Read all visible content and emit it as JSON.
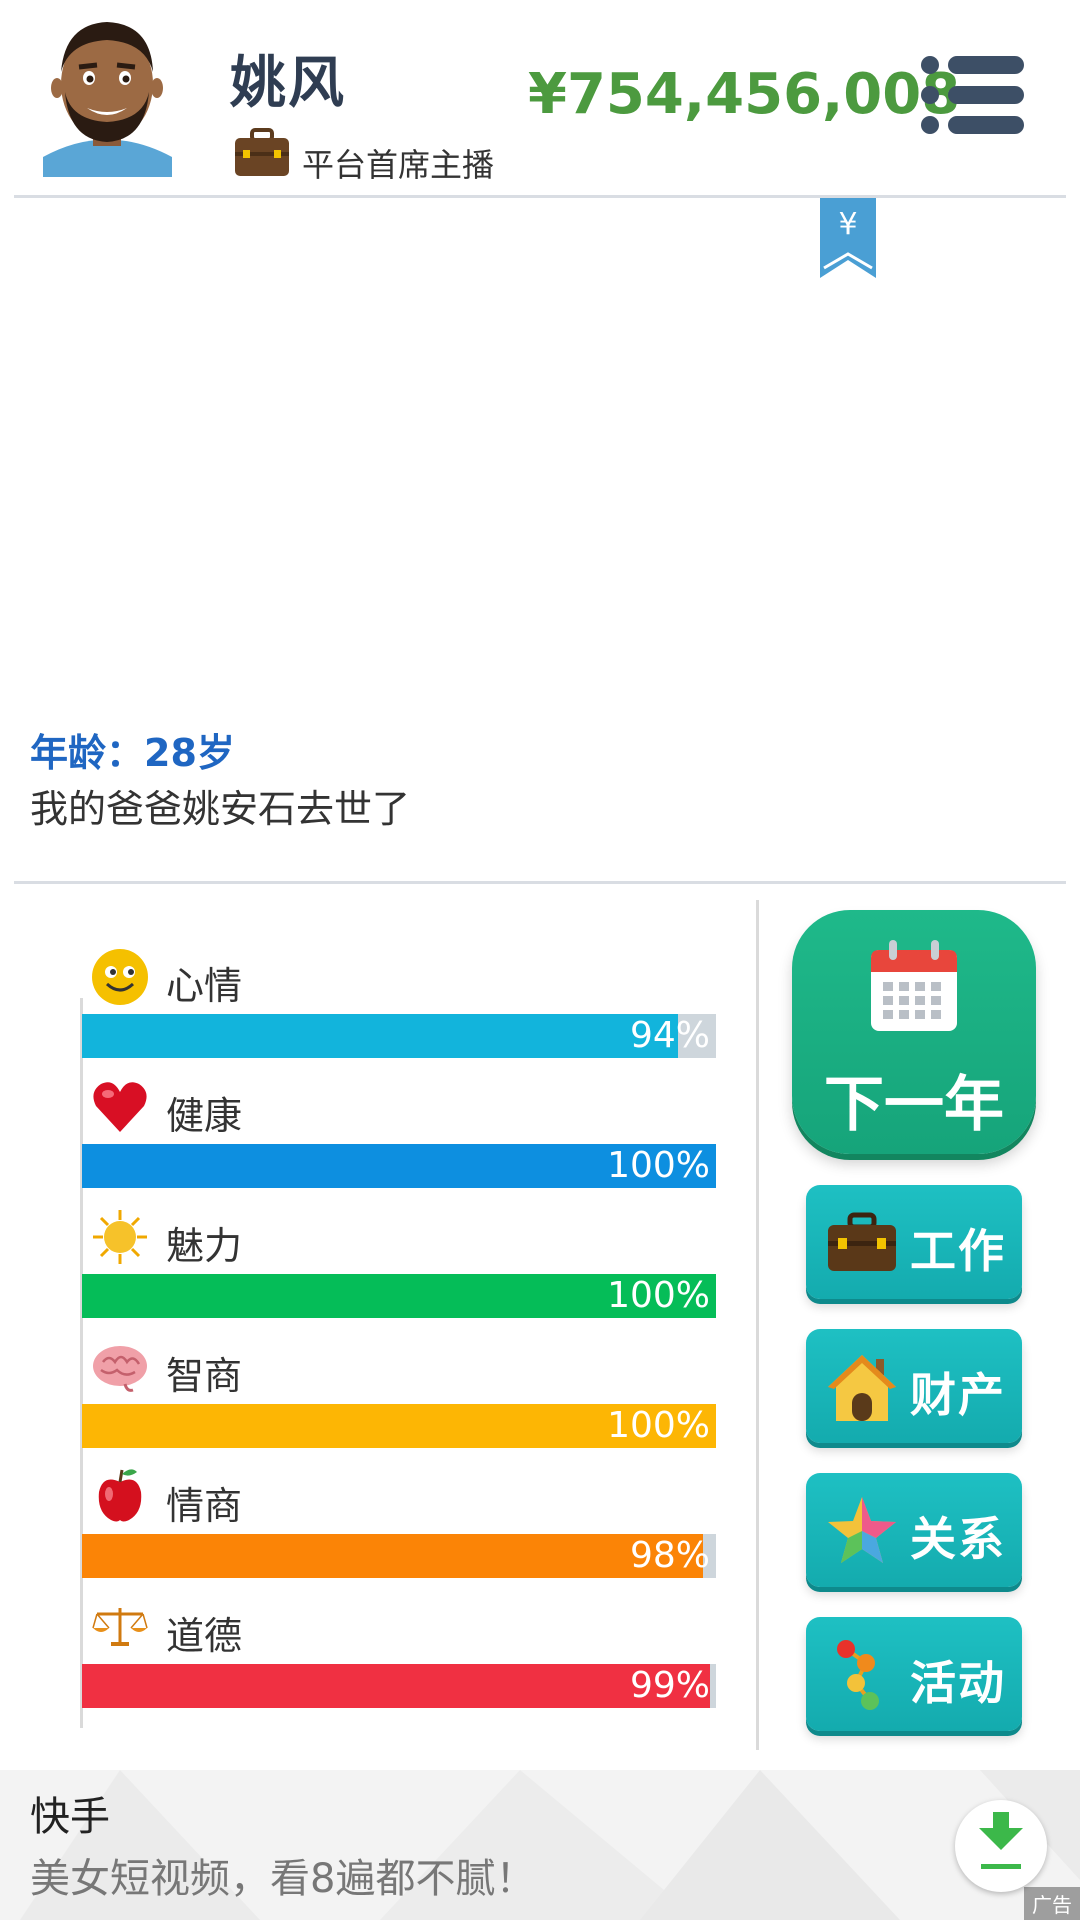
{
  "header": {
    "name": "姚风",
    "job_title": "平台首席主播",
    "money": "¥754,456,008",
    "menu_icon": "menu-icon"
  },
  "bookmark": {
    "symbol": "¥",
    "icon": "yen-bookmark-icon"
  },
  "log": {
    "age": "年龄：28岁",
    "event": "我的爸爸姚安石去世了"
  },
  "stats": [
    {
      "label": "心情",
      "percent_text": "94%",
      "value": 94,
      "color": "#12b4dc",
      "icon": "smiley-icon"
    },
    {
      "label": "健康",
      "percent_text": "100%",
      "value": 100,
      "color": "#0d8fe0",
      "icon": "heart-icon"
    },
    {
      "label": "魅力",
      "percent_text": "100%",
      "value": 100,
      "color": "#05bd58",
      "icon": "sun-icon"
    },
    {
      "label": "智商",
      "percent_text": "100%",
      "value": 100,
      "color": "#fdb604",
      "icon": "brain-icon"
    },
    {
      "label": "情商",
      "percent_text": "98%",
      "value": 98,
      "color": "#fb8406",
      "icon": "apple-icon"
    },
    {
      "label": "道德",
      "percent_text": "99%",
      "value": 99,
      "color": "#f03042",
      "icon": "scales-icon"
    }
  ],
  "buttons": {
    "next_year": "下一年",
    "work": "工作",
    "assets": "财产",
    "relations": "关系",
    "activities": "活动"
  },
  "ad": {
    "title": "快手",
    "text": "美女短视频，看8遍都不腻！",
    "tag": "广告"
  },
  "colors": {
    "money": "#4c9a3f",
    "age": "#1f66c2",
    "next_button": "#1fb98a",
    "action_button": "#1ec0c3"
  }
}
